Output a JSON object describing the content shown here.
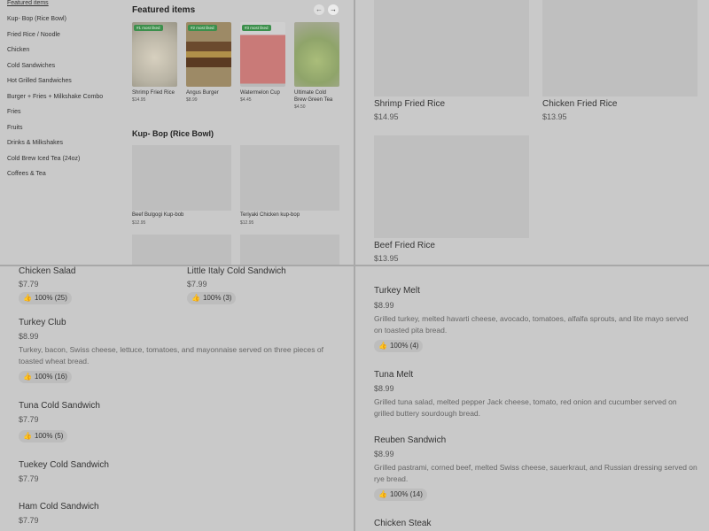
{
  "sidebar": {
    "items": [
      "Featured items",
      "Kup- Bop (Rice Bowl)",
      "Fried Rice / Noodle",
      "Chicken",
      "Cold Sandwiches",
      "Hot Grilled Sandwiches",
      "Burger + Fries + Milkshake Combo",
      "Fries",
      "Fruits",
      "Drinks & Milkshakes",
      "Cold Brew Iced Tea (24oz)",
      "Coffees & Tea"
    ]
  },
  "featured": {
    "title": "Featured items",
    "prev_icon": "arrow-left-icon",
    "next_icon": "arrow-right-icon",
    "items": [
      {
        "badge": "#1 most liked",
        "name": "Shrimp Fried Rice",
        "price": "$14.95",
        "color": "#b8b3a4"
      },
      {
        "badge": "#2 most liked",
        "name": "Angus Burger",
        "price": "$8.99",
        "color": "#8a6a45"
      },
      {
        "badge": "#3 most liked",
        "name": "Watermelon Cup",
        "price": "$4.45",
        "color": "#c97a78"
      },
      {
        "badge": "",
        "name": "Ultimate Cold Brew Green Tea",
        "price": "$4.50",
        "color": "#8fa46a"
      }
    ]
  },
  "kupbop": {
    "title": "Kup- Bop (Rice Bowl)",
    "items": [
      {
        "name": "Beef Bulgogi Kup-bob",
        "price": "$12.95"
      },
      {
        "name": "Teriyaki Chicken kup-bop",
        "price": "$12.95"
      }
    ]
  },
  "fried_rice": {
    "items": [
      {
        "name": "Shrimp Fried Rice",
        "price": "$14.95"
      },
      {
        "name": "Chicken Fried Rice",
        "price": "$13.95"
      },
      {
        "name": "Beef Fried Rice",
        "price": "$13.95"
      }
    ]
  },
  "cold_sandwiches": {
    "items": [
      {
        "name": "Chicken Salad",
        "price": "$7.79",
        "like": "100% (25)"
      },
      {
        "name": "Little Italy Cold Sandwich",
        "price": "$7.99",
        "like": "100% (3)"
      },
      {
        "name": "Turkey Club",
        "price": "$8.99",
        "desc": "Turkey, bacon, Swiss cheese, lettuce, tomatoes, and mayonnaise served on three pieces of toasted wheat bread.",
        "like": "100% (16)"
      },
      {
        "name": "Tuna Cold Sandwich",
        "price": "$7.79",
        "like": "100% (5)"
      },
      {
        "name": "Tuekey Cold Sandwich",
        "price": "$7.79"
      },
      {
        "name": "Ham Cold Sandwich",
        "price": "$7.79"
      }
    ]
  },
  "hot_sandwiches": {
    "items": [
      {
        "name": "Turkey Melt",
        "price": "$8.99",
        "desc": "Grilled turkey, melted havarti cheese, avocado, tomatoes, alfalfa sprouts, and lite mayo served on toasted pita bread.",
        "like": "100% (4)"
      },
      {
        "name": "Tuna Melt",
        "price": "$8.99",
        "desc": "Grilled tuna salad, melted pepper Jack cheese, tomato, red onion and cucumber served on grilled buttery sourdough bread."
      },
      {
        "name": "Reuben Sandwich",
        "price": "$8.99",
        "desc": "Grilled pastrami, corned beef, melted Swiss cheese, sauerkraut, and Russian dressing served on rye bread.",
        "like": "100% (14)"
      },
      {
        "name": "Chicken Steak"
      }
    ]
  },
  "like_icon": "thumbs-up-icon"
}
